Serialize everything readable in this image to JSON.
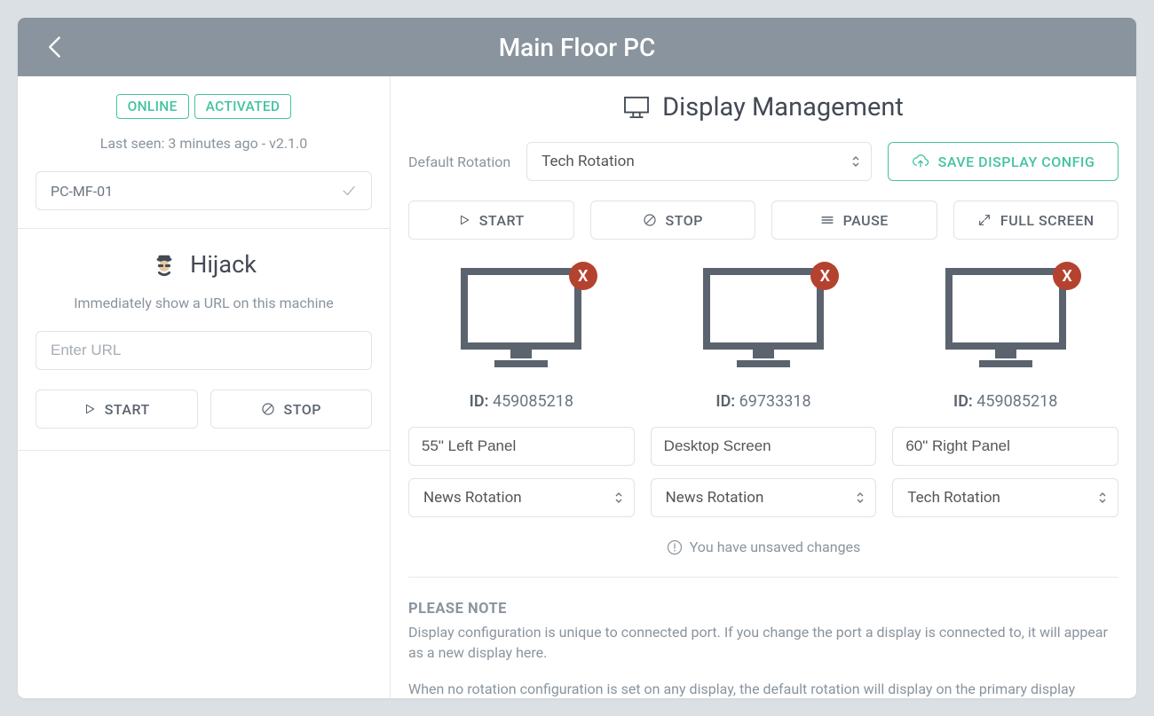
{
  "header": {
    "title": "Main Floor PC"
  },
  "sidebar": {
    "status": {
      "online": "ONLINE",
      "activated": "ACTIVATED"
    },
    "last_seen": "Last seen: 3 minutes ago - v2.1.0",
    "machine_name": "PC-MF-01",
    "hijack": {
      "title": "Hijack",
      "description": "Immediately show a URL on this machine",
      "url_placeholder": "Enter URL",
      "start_label": "START",
      "stop_label": "STOP"
    }
  },
  "main": {
    "title": "Display Management",
    "default_rotation_label": "Default Rotation",
    "default_rotation_value": "Tech Rotation",
    "save_label": "SAVE DISPLAY CONFIG",
    "actions": {
      "start": "START",
      "stop": "STOP",
      "pause": "PAUSE",
      "fullscreen": "FULL SCREEN"
    },
    "id_label": "ID:",
    "displays": [
      {
        "id": "459085218",
        "name": "55\" Left Panel",
        "rotation": "News Rotation"
      },
      {
        "id": "69733318",
        "name": "Desktop Screen",
        "rotation": "News Rotation"
      },
      {
        "id": "459085218",
        "name": "60\" Right Panel",
        "rotation": "Tech Rotation"
      }
    ],
    "unsaved_message": "You have unsaved changes",
    "note": {
      "heading": "PLEASE NOTE",
      "p1": "Display configuration is unique to connected port. If you change the port a display is connected to, it will appear as a new display here.",
      "p2": "When no rotation configuration is set on any display, the default rotation will display on the primary display"
    }
  }
}
